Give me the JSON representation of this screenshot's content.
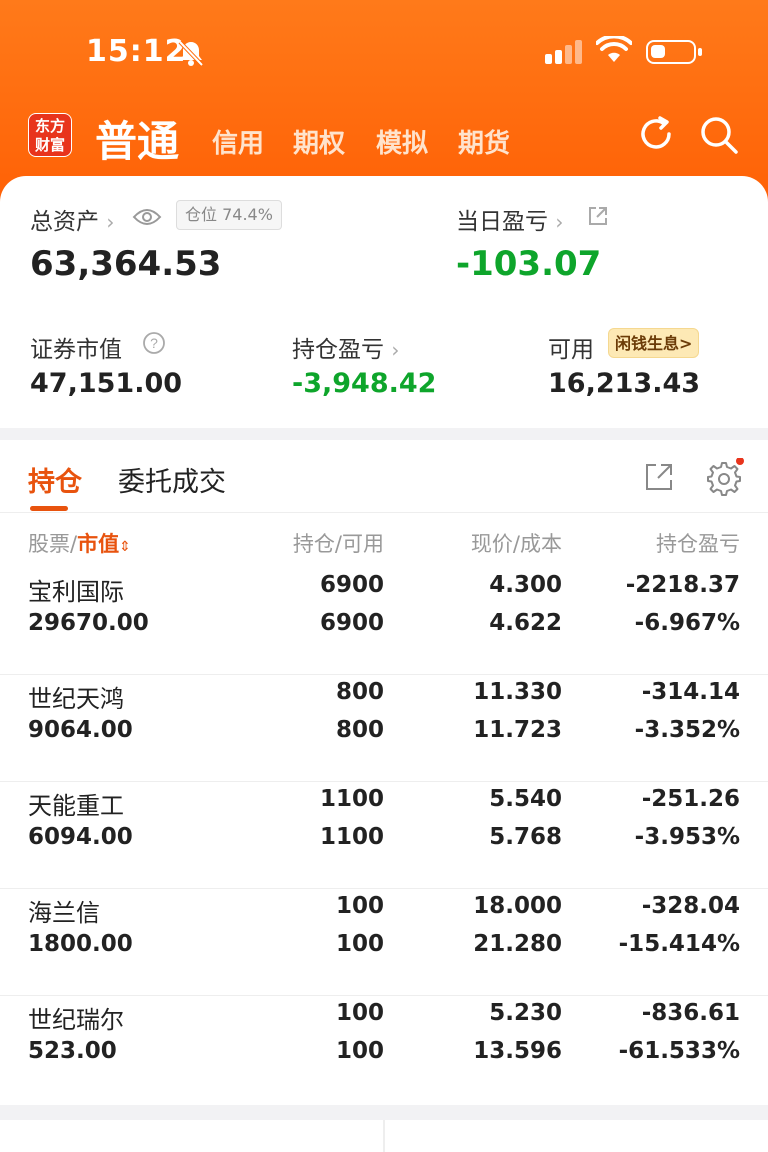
{
  "status_bar": {
    "time": "15:12"
  },
  "logo": {
    "line1": "东方",
    "line2": "财富"
  },
  "header_tabs": {
    "active": "普通",
    "others": [
      "信用",
      "期权",
      "模拟",
      "期货"
    ]
  },
  "account": {
    "total_assets_label": "总资产",
    "total_assets_value": "63,364.53",
    "position_ratio": "仓位 74.4%",
    "daily_pl_label": "当日盈亏",
    "daily_pl_value": "-103.07",
    "market_value_label": "证券市值",
    "market_value": "47,151.00",
    "holding_pl_label": "持仓盈亏",
    "holding_pl_value": "-3,948.42",
    "available_label": "可用",
    "available_value": "16,213.43",
    "idle_badge": "闲钱生息>"
  },
  "tabs": {
    "holdings": "持仓",
    "orders": "委托成交"
  },
  "table": {
    "headers": {
      "stock": "股票",
      "slash": "/",
      "market_value": "市值",
      "qty": "持仓/可用",
      "price": "现价/成本",
      "pl": "持仓盈亏"
    },
    "rows": [
      {
        "name": "宝利国际",
        "mv": "29670.00",
        "qty": "6900",
        "avail": "6900",
        "price": "4.300",
        "cost": "4.622",
        "pl": "-2218.37",
        "plpct": "-6.967%"
      },
      {
        "name": "世纪天鸿",
        "mv": "9064.00",
        "qty": "800",
        "avail": "800",
        "price": "11.330",
        "cost": "11.723",
        "pl": "-314.14",
        "plpct": "-3.352%"
      },
      {
        "name": "天能重工",
        "mv": "6094.00",
        "qty": "1100",
        "avail": "1100",
        "price": "5.540",
        "cost": "5.768",
        "pl": "-251.26",
        "plpct": "-3.953%"
      },
      {
        "name": "海兰信",
        "mv": "1800.00",
        "qty": "100",
        "avail": "100",
        "price": "18.000",
        "cost": "21.280",
        "pl": "-328.04",
        "plpct": "-15.414%"
      },
      {
        "name": "世纪瑞尔",
        "mv": "523.00",
        "qty": "100",
        "avail": "100",
        "price": "5.230",
        "cost": "13.596",
        "pl": "-836.61",
        "plpct": "-61.533%"
      }
    ]
  },
  "colors": {
    "brand_orange": "#ff5a00",
    "accent": "#e8530e",
    "loss_green": "#0ea52b"
  },
  "icons": [
    "bell-slash-icon",
    "signal-icon",
    "wifi-icon",
    "battery-icon",
    "refresh-icon",
    "search-icon",
    "eye-icon",
    "external-link-icon",
    "help-icon",
    "export-icon",
    "gear-icon"
  ]
}
